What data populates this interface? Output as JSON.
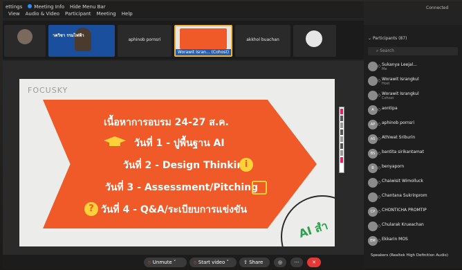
{
  "menu": {
    "left_label": "ettings",
    "meeting_info": "Meeting Info",
    "hide_menu": "Hide Menu Bar",
    "items": [
      "View",
      "Audio & Video",
      "Participant",
      "Meeting",
      "Help"
    ],
    "connected": "Connected"
  },
  "thumbnails": [
    {
      "name": ""
    },
    {
      "name": "",
      "banner": "าควิชา     รรมไฟฟ้า"
    },
    {
      "name": "aphinob pornsri"
    },
    {
      "name": "Worawit Isran... (Cohost)"
    },
    {
      "name": "akkhol buachan"
    },
    {
      "name": ""
    }
  ],
  "slide": {
    "brand": "FOCUSKY",
    "title": "เนื้อหาการอบรม 24-27 ส.ค.",
    "lines": [
      "วันที่ 1 - ปูพื้นฐาน AI",
      "วันที่ 2 - Design Thinking",
      "วันที่ 3 - Assessment/Pitching",
      "วันที่ 4 - Q&A/ระเบียบการแข่งขัน"
    ],
    "corner_text": "AI สำ",
    "accent_color": "#f05a28"
  },
  "toolbar": {
    "unmute": "Unmute",
    "start_video": "Start video",
    "share": "Share",
    "more1": "◎",
    "more2": "···",
    "end": "✕"
  },
  "participants": {
    "header": "Participants (87)",
    "search_placeholder": "Search",
    "list": [
      {
        "name": "Sukanya Leejal...",
        "sub": "Me",
        "initials": ""
      },
      {
        "name": "Worawit Israngkul",
        "sub": "Host",
        "initials": ""
      },
      {
        "name": "Worawit Israngkul",
        "sub": "Cohost",
        "initials": ""
      },
      {
        "name": "aontipa",
        "sub": "",
        "initials": "A"
      },
      {
        "name": "aphinob pornsri",
        "sub": "",
        "initials": "AP"
      },
      {
        "name": "Athiwat Sriburin",
        "sub": "",
        "initials": "AS"
      },
      {
        "name": "bantita sirikantamat",
        "sub": "",
        "initials": "BS"
      },
      {
        "name": "benyaporn",
        "sub": "",
        "initials": "B"
      },
      {
        "name": "Chaiwisit Wimolluck",
        "sub": "",
        "initials": ""
      },
      {
        "name": "Chantana Sukrinprom",
        "sub": "",
        "initials": ""
      },
      {
        "name": "CHONTICHA PROMTIP",
        "sub": "",
        "initials": "CP"
      },
      {
        "name": "Chularak Krueachan",
        "sub": "",
        "initials": ""
      },
      {
        "name": "Ekkarin MOS",
        "sub": "",
        "initials": "EM"
      }
    ],
    "footer": "Speakers (Realtek High Definition Audio)"
  }
}
